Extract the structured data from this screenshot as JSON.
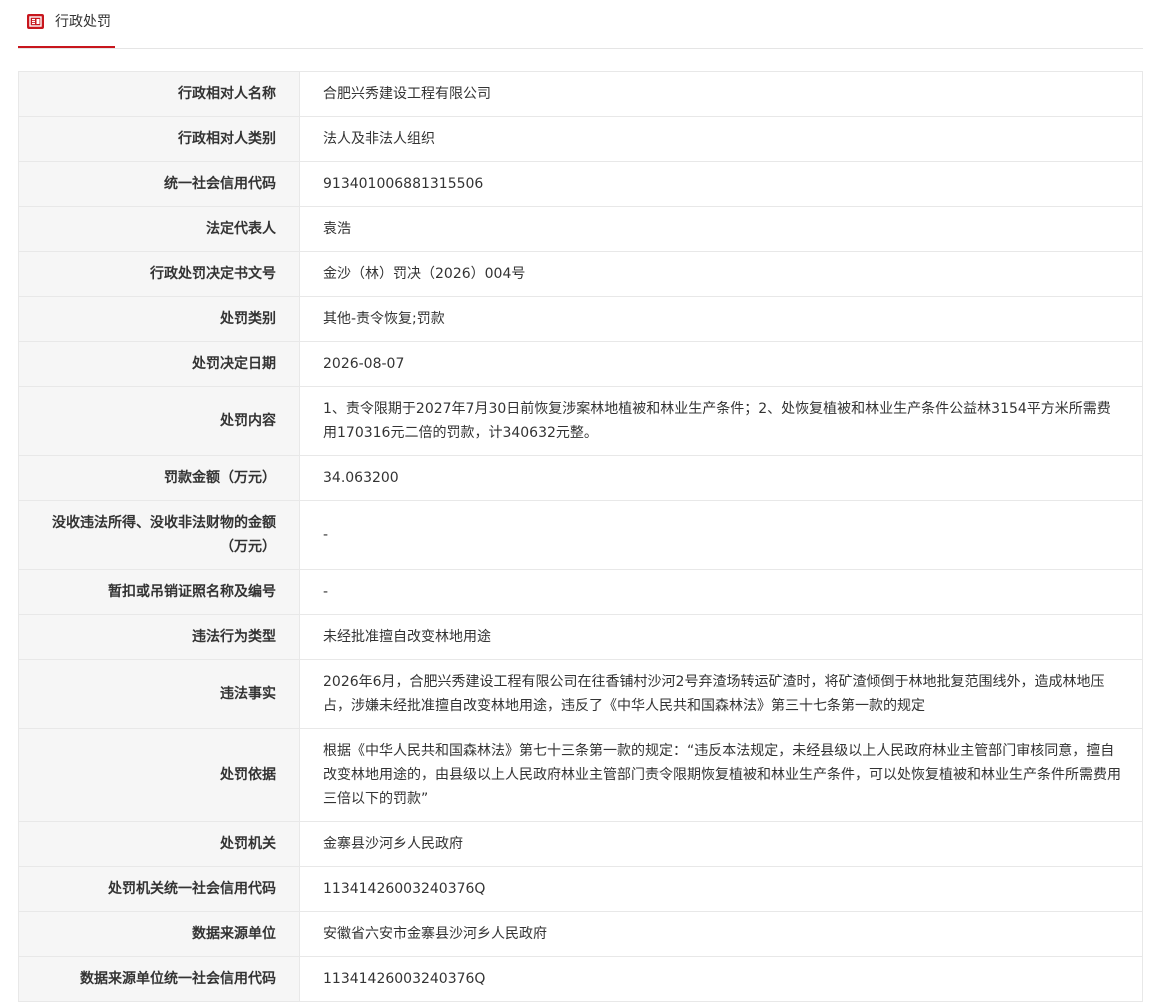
{
  "tab": {
    "icon": "document-card-icon",
    "label": "行政处罚"
  },
  "colors": {
    "accent": "#c8161d",
    "label_bg": "#f6f6f6",
    "border": "#e8e8e8",
    "text": "#333333"
  },
  "rows": [
    {
      "label": "行政相对人名称",
      "value": "合肥兴秀建设工程有限公司"
    },
    {
      "label": "行政相对人类别",
      "value": "法人及非法人组织"
    },
    {
      "label": "统一社会信用代码",
      "value": "913401006881315506"
    },
    {
      "label": "法定代表人",
      "value": "袁浩"
    },
    {
      "label": "行政处罚决定书文号",
      "value": "金沙（林）罚决（2026）004号"
    },
    {
      "label": "处罚类别",
      "value": "其他-责令恢复;罚款"
    },
    {
      "label": "处罚决定日期",
      "value": "2026-08-07"
    },
    {
      "label": "处罚内容",
      "value": "1、责令限期于2027年7月30日前恢复涉案林地植被和林业生产条件；2、处恢复植被和林业生产条件公益林3154平方米所需费用170316元二倍的罚款，计340632元整。"
    },
    {
      "label": "罚款金额（万元）",
      "value": "34.063200"
    },
    {
      "label": "没收违法所得、没收非法财物的金额（万元）",
      "value": "-"
    },
    {
      "label": "暂扣或吊销证照名称及编号",
      "value": "-"
    },
    {
      "label": "违法行为类型",
      "value": "未经批准擅自改变林地用途"
    },
    {
      "label": "违法事实",
      "value": "2026年6月，合肥兴秀建设工程有限公司在往香铺村沙河2号弃渣场转运矿渣时，将矿渣倾倒于林地批复范围线外，造成林地压占，涉嫌未经批准擅自改变林地用途，违反了《中华人民共和国森林法》第三十七条第一款的规定"
    },
    {
      "label": "处罚依据",
      "value": "根据《中华人民共和国森林法》第七十三条第一款的规定：“违反本法规定，未经县级以上人民政府林业主管部门审核同意，擅自改变林地用途的，由县级以上人民政府林业主管部门责令限期恢复植被和林业生产条件，可以处恢复植被和林业生产条件所需费用三倍以下的罚款”"
    },
    {
      "label": "处罚机关",
      "value": "金寨县沙河乡人民政府"
    },
    {
      "label": "处罚机关统一社会信用代码",
      "value": "11341426003240376Q"
    },
    {
      "label": "数据来源单位",
      "value": "安徽省六安市金寨县沙河乡人民政府"
    },
    {
      "label": "数据来源单位统一社会信用代码",
      "value": "11341426003240376Q"
    }
  ]
}
